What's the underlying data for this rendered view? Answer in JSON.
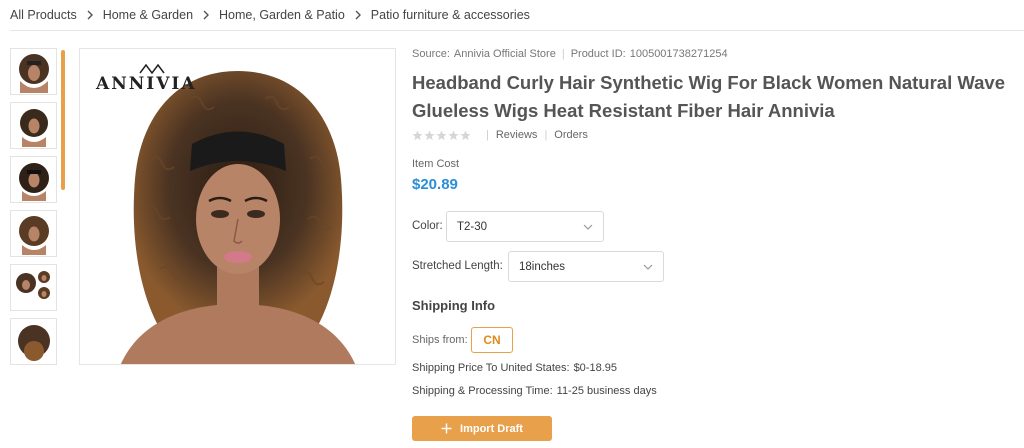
{
  "breadcrumb": [
    "All Products",
    "Home & Garden",
    "Home, Garden & Patio",
    "Patio furniture & accessories"
  ],
  "product": {
    "source_label": "Source:",
    "source": "Annivia Official Store",
    "product_id_label": "Product ID:",
    "product_id": "1005001738271254",
    "title": "Headband Curly Hair Synthetic Wig For Black Women Natural Wave Glueless Wigs Heat Resistant Fiber Hair Annivia",
    "rating": 0,
    "reviews_label": "Reviews",
    "orders_label": "Orders",
    "cost_label": "Item Cost",
    "price": "$20.89",
    "brand_logo_text": "ANNIVIA"
  },
  "options": {
    "color_label": "Color:",
    "color_value": "T2-30",
    "length_label": "Stretched Length:",
    "length_value": "18inches"
  },
  "shipping": {
    "title": "Shipping Info",
    "ships_from_label": "Ships from:",
    "ships_from_value": "CN",
    "price_label": "Shipping Price To United States:",
    "price_value": "$0-18.95",
    "time_label": "Shipping & Processing Time:",
    "time_value": "11-25 business days"
  },
  "actions": {
    "import_label": "Import Draft"
  },
  "colors": {
    "accent": "#e8a14a",
    "price": "#2a8fd6",
    "hair_dark": "#3a2a1c",
    "hair_light": "#8a5a2e",
    "skin": "#b88468"
  }
}
